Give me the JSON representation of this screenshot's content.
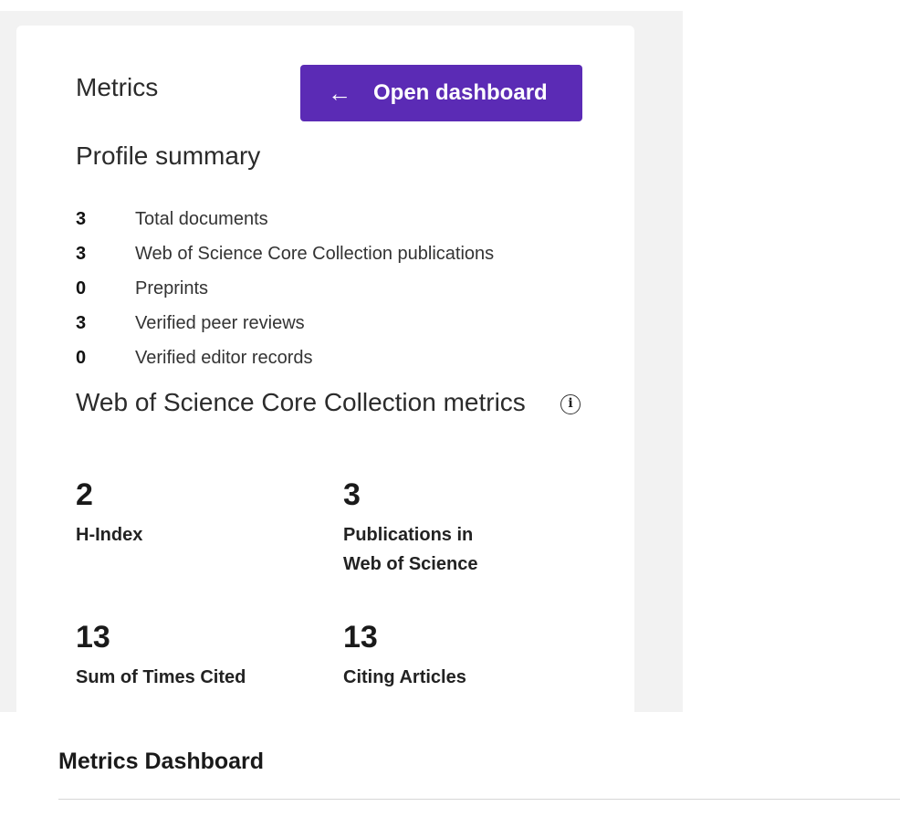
{
  "card": {
    "title": "Metrics",
    "open_dashboard_button": {
      "icon": "arrow-left-icon",
      "label": "Open dashboard"
    },
    "profile_summary": {
      "title": "Profile summary",
      "items": [
        {
          "count": "3",
          "label": "Total documents"
        },
        {
          "count": "3",
          "label": "Web of Science Core Collection publications"
        },
        {
          "count": "0",
          "label": "Preprints"
        },
        {
          "count": "3",
          "label": "Verified peer reviews"
        },
        {
          "count": "0",
          "label": "Verified editor records"
        }
      ]
    },
    "core_metrics": {
      "title": "Web of Science Core Collection metrics",
      "info_icon": "info-icon",
      "metrics": [
        {
          "value": "2",
          "label": "H-Index"
        },
        {
          "value": "3",
          "label": "Publications in Web of Science"
        },
        {
          "value": "13",
          "label": "Sum of Times Cited"
        },
        {
          "value": "13",
          "label": "Citing Articles"
        }
      ]
    }
  },
  "dashboard": {
    "title": "Metrics Dashboard"
  },
  "colors": {
    "accent": "#5b2bb5",
    "backdrop": "#f2f2f2"
  }
}
